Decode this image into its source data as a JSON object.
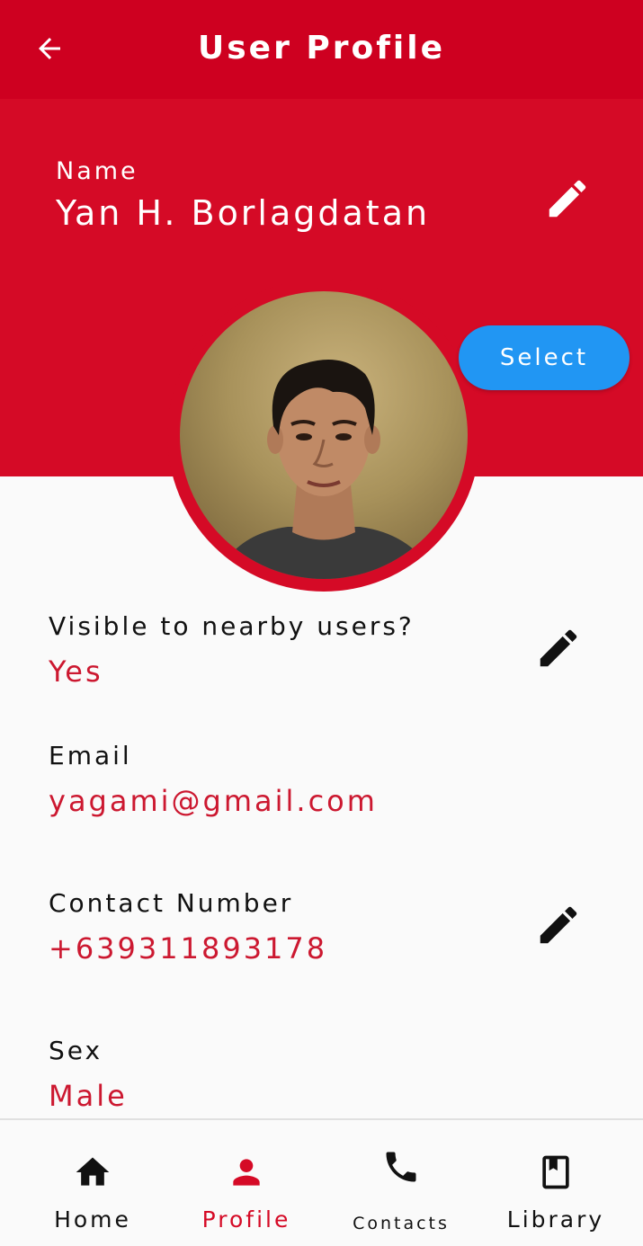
{
  "appbar": {
    "title": "User Profile",
    "back_icon": "arrow-back-icon"
  },
  "profile": {
    "name_label": "Name",
    "name_value": "Yan H. Borlagdatan",
    "select_label": "Select",
    "avatar_icon": "profile-photo"
  },
  "fields": [
    {
      "label": "Visible to nearby users?",
      "value": "Yes",
      "editable": true
    },
    {
      "label": "Email",
      "value": "yagami@gmail.com",
      "editable": false
    },
    {
      "label": "Contact Number",
      "value": "+639311893178",
      "editable": true
    },
    {
      "label": "Sex",
      "value": "Male",
      "editable": false
    }
  ],
  "nav": {
    "items": [
      {
        "label": "Home",
        "icon": "home-icon",
        "active": false
      },
      {
        "label": "Profile",
        "icon": "person-icon",
        "active": true
      },
      {
        "label": "Contacts",
        "icon": "phone-icon",
        "active": false
      },
      {
        "label": "Library",
        "icon": "book-icon",
        "active": false
      }
    ]
  },
  "colors": {
    "appbar": "#ce0020",
    "header": "#d50a26",
    "accent_text": "#cc1830",
    "select_button": "#2196f3",
    "background": "#fafafa"
  }
}
